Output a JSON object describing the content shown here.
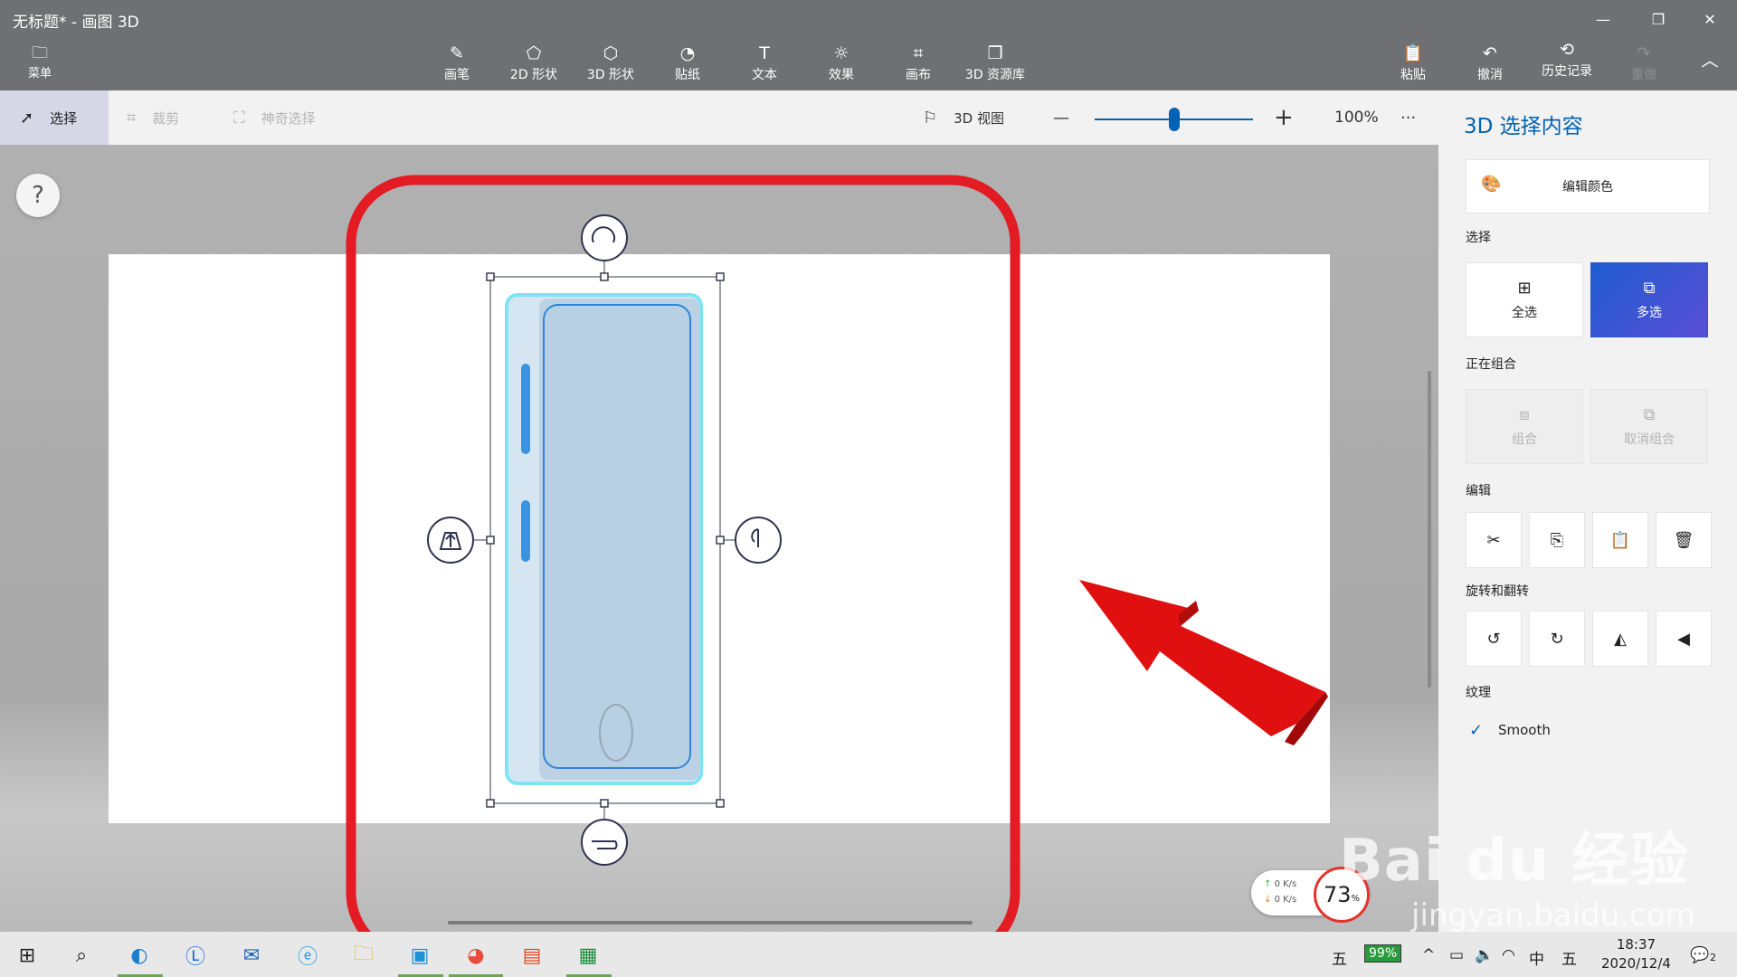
{
  "window": {
    "title": "无标题* - 画图 3D",
    "minimize": "—",
    "maximize": "❐",
    "close": "✕"
  },
  "ribbon": {
    "menu": "菜单",
    "tools": [
      {
        "label": "画笔",
        "icon": "brush-icon"
      },
      {
        "label": "2D 形状",
        "icon": "2d-shapes-icon"
      },
      {
        "label": "3D 形状",
        "icon": "3d-shapes-icon"
      },
      {
        "label": "贴纸",
        "icon": "stickers-icon"
      },
      {
        "label": "文本",
        "icon": "text-icon"
      },
      {
        "label": "效果",
        "icon": "effects-icon"
      },
      {
        "label": "画布",
        "icon": "canvas-icon"
      },
      {
        "label": "3D 资源库",
        "icon": "3d-library-icon"
      }
    ],
    "paste": "粘贴",
    "undo": "撤消",
    "history": "历史记录",
    "redo": "重做"
  },
  "subbar": {
    "select": "选择",
    "crop": "裁剪",
    "magic_select": "神奇选择",
    "view3d": "3D 视图",
    "zoom_minus": "—",
    "zoom_plus": "+",
    "zoom": "100%",
    "more": "···",
    "zoom_value": 0.5
  },
  "canvas": {
    "help": "?"
  },
  "panel": {
    "title": "3D 选择内容",
    "edit_color": "编辑颜色",
    "select_label": "选择",
    "select_all": "全选",
    "multi_select": "多选",
    "grouping_label": "正在组合",
    "group": "组合",
    "ungroup": "取消组合",
    "edit_label": "编辑",
    "rotate_label": "旋转和翻转",
    "texture_label": "纹理",
    "smooth": "Smooth"
  },
  "widget": {
    "up": "0  K/s",
    "down": "0  K/s",
    "percent": "73",
    "percent_sign": "%"
  },
  "taskbar": {
    "ime1": "五",
    "battery": "99%",
    "lang": "中",
    "ime2": "五",
    "time": "18:37",
    "date": "2020/12/4",
    "notify_count": "2"
  },
  "watermark": {
    "brand": "Bai du 经验",
    "url": "jingyan.baidu.com"
  },
  "colors": {
    "accent": "#0063b1",
    "highlight_box": "#e31b23",
    "arrow": "#e01010",
    "phone": "#b7d0e3"
  }
}
